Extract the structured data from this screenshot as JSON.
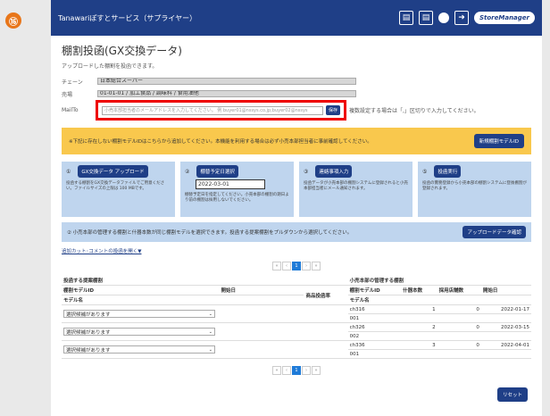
{
  "step_badge": "⑯",
  "topbar": {
    "title": "Tanawariぽすとサービス（サプライヤー）",
    "icons": [
      "manual-icon",
      "manual-icon",
      "user-icon",
      "logout-icon"
    ],
    "icon_labels": [
      "サプライヤー",
      "小売本部",
      "アカウント情報",
      "ログアウト"
    ],
    "logo": "StoreManager"
  },
  "page": {
    "title": "棚割投函(GX交換データ)",
    "subtitle": "アップロードした棚割を投函できます。"
  },
  "form": {
    "chain_label": "チェーン",
    "chain_value": "日本総合スーパー",
    "dest_label": "売場",
    "dest_value": "01-01-01 / 加工食品 / 調味料 / 食用油他",
    "mailto_label": "MailTo",
    "mailto_placeholder": "小売本部担当者のメールアドレスを入力してください。 例 buyer01@nssys.co.jp;buyer02@nssys",
    "save_label": "保存",
    "mailto_hint": "複数設定する場合は「,」区切りで入力してください。"
  },
  "notice": {
    "text": "※下記に存在しない棚割モデルIDはこちらから追加してください。本機能を利用する場合は必ず小売本部担当者に事前確認してください。",
    "button": "新規棚割モデルID"
  },
  "steps": [
    {
      "num": "①",
      "button": "GX交換データ アップロード",
      "desc": "投函する棚割をGX交換データファイルでご用意ください。ファイルサイズの上限は 100 MBです。"
    },
    {
      "num": "②",
      "button": "棚替予定日選択",
      "date": "2022-03-01",
      "desc": "棚替予定日を指定してください。小売本部の棚割の期日より前の棚割は採用しないでください。"
    },
    {
      "num": "③",
      "button": "連絡事項入力",
      "desc": "投函データが小売本部の棚割システムに登録されると小売本部担当者にメール通知されます。"
    },
    {
      "num": "⑤",
      "button": "投函実行",
      "desc": "投函の實務登録から小売本部の棚割システムに登後棚割が登録されます。"
    }
  ],
  "filter": {
    "text": "② 小売本部の管理する棚割と什器本数が同じ棚割モデルを選択できます。投函する提案棚割をプルダウンから選択してください。",
    "button": "アップロードデータ確認"
  },
  "link_text": "追加カット･コメントの投函を開く▼",
  "pager": [
    "«",
    "‹",
    "1",
    "›",
    "»"
  ],
  "table": {
    "left_header": "投函する提案棚割",
    "right_header": "小売本部の管理する棚割",
    "col_model_id": "棚割モデルID",
    "col_start": "開始日",
    "col_model_name": "モデル名",
    "col_rate": "商品投函率",
    "col_fixtures": "什器本数",
    "col_adopted": "採用店舗数",
    "rows": [
      {
        "select": "選択候補があります",
        "id": "ch316",
        "name": "001",
        "fixtures": "1",
        "adopted": "0",
        "start": "2022-01-17"
      },
      {
        "select": "選択候補があります",
        "id": "ch326",
        "name": "002",
        "fixtures": "2",
        "adopted": "0",
        "start": "2022-03-15"
      },
      {
        "select": "選択候補があります",
        "id": "ch336",
        "name": "001",
        "fixtures": "3",
        "adopted": "0",
        "start": "2022-04-01"
      }
    ]
  },
  "reset_label": "リセット"
}
